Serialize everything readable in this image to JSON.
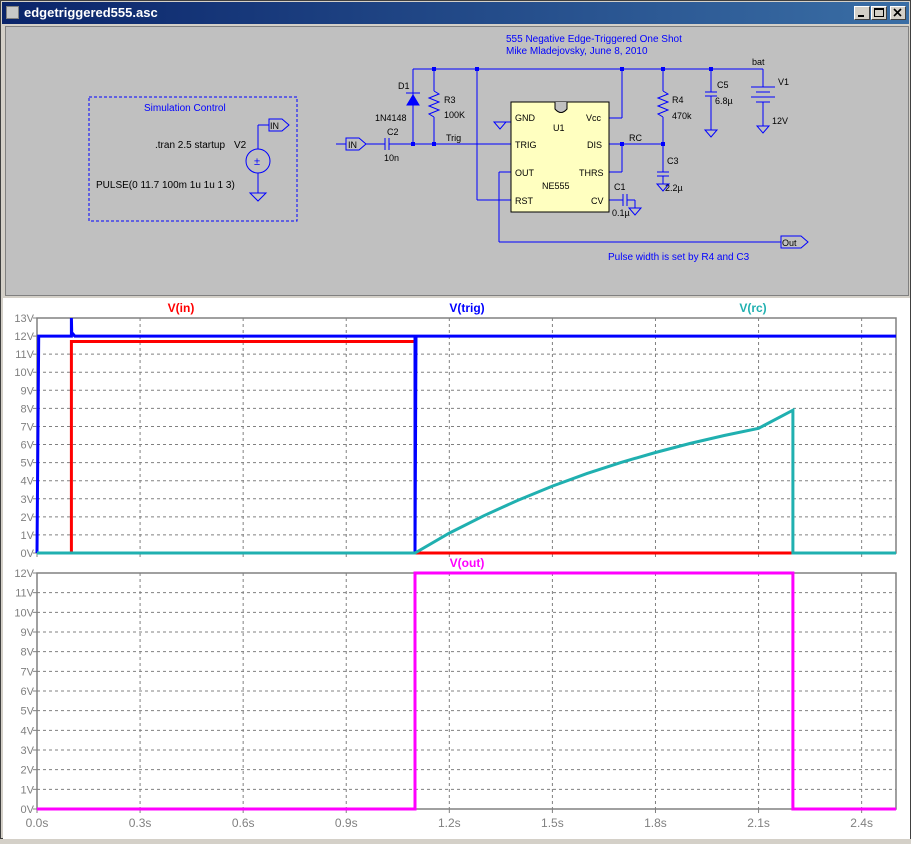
{
  "window": {
    "title": "edgetriggered555.asc"
  },
  "schematic": {
    "title_line1": "555 Negative Edge-Triggered One Shot",
    "title_line2": "Mike Mladejovsky, June 8, 2010",
    "note": "Pulse width is set by R4 and C3",
    "sim_box_label": "Simulation Control",
    "directive": ".tran 2.5 startup",
    "source_name": "V2",
    "source_value": "PULSE(0 11.7 100m 1u 1u 1 3)",
    "in_flag_1": "IN",
    "in_flag_2": "IN",
    "out_flag": "Out",
    "bat_label": "bat",
    "net_trig": "Trig",
    "net_rc": "RC",
    "d1_name": "D1",
    "d1_value": "1N4148",
    "r3_name": "R3",
    "r3_value": "100K",
    "c2_name": "C2",
    "c2_value": "10n",
    "r4_name": "R4",
    "r4_value": "470k",
    "c3_name": "C3",
    "c3_value": "2.2µ",
    "c5_name": "C5",
    "c5_value": "6.8µ",
    "v1_name": "V1",
    "v1_value": "12V",
    "c1_name": "C1",
    "c1_value": "0.1µ",
    "u1_name": "U1",
    "u1_part": "NE555",
    "pins": {
      "gnd": "GND",
      "trig": "TRIG",
      "out": "OUT",
      "rst": "RST",
      "vcc": "Vcc",
      "dis": "DIS",
      "thrs": "THRS",
      "cv": "CV"
    }
  },
  "chart_data": [
    {
      "type": "line",
      "x_ticks": [
        "0.0s",
        "0.3s",
        "0.6s",
        "0.9s",
        "1.2s",
        "1.5s",
        "1.8s",
        "2.1s",
        "2.4s"
      ],
      "y_ticks": [
        "0V",
        "1V",
        "2V",
        "3V",
        "4V",
        "5V",
        "6V",
        "7V",
        "8V",
        "9V",
        "10V",
        "11V",
        "12V",
        "13V"
      ],
      "xlim": [
        0,
        2.5
      ],
      "ylim": [
        0,
        13
      ],
      "grid": true,
      "series": [
        {
          "name": "V(in)",
          "color": "#ff0000",
          "x": [
            0,
            0.1,
            0.1,
            1.1,
            1.1,
            2.5
          ],
          "y": [
            0,
            0,
            11.7,
            11.7,
            0,
            0
          ]
        },
        {
          "name": "V(trig)",
          "color": "#0000ff",
          "x": [
            0,
            0.005,
            0.095,
            0.1,
            0.1,
            0.101,
            0.11,
            1.1,
            1.1,
            1.103,
            2.5
          ],
          "y": [
            0,
            12,
            12,
            12,
            13,
            12.2,
            12,
            12,
            0,
            12,
            12
          ]
        },
        {
          "name": "V(rc)",
          "color": "#20b0b0",
          "x": [
            0,
            1.1,
            1.2,
            1.3,
            1.4,
            1.5,
            1.6,
            1.7,
            1.8,
            1.9,
            2.0,
            2.1,
            2.2,
            2.2,
            2.5
          ],
          "y": [
            0,
            0,
            1.1,
            2.06,
            2.92,
            3.7,
            4.39,
            5.01,
            5.56,
            6.06,
            6.5,
            6.9,
            7.9,
            0,
            0
          ]
        }
      ]
    },
    {
      "type": "line",
      "x_ticks": [
        "0.0s",
        "0.3s",
        "0.6s",
        "0.9s",
        "1.2s",
        "1.5s",
        "1.8s",
        "2.1s",
        "2.4s"
      ],
      "y_ticks": [
        "0V",
        "1V",
        "2V",
        "3V",
        "4V",
        "5V",
        "6V",
        "7V",
        "8V",
        "9V",
        "10V",
        "11V",
        "12V"
      ],
      "xlim": [
        0,
        2.5
      ],
      "ylim": [
        0,
        12
      ],
      "grid": true,
      "series": [
        {
          "name": "V(out)",
          "color": "#ff00ff",
          "x": [
            0,
            1.1,
            1.1,
            2.2,
            2.2,
            2.5
          ],
          "y": [
            0,
            0,
            12,
            12,
            0,
            0
          ]
        }
      ]
    }
  ]
}
